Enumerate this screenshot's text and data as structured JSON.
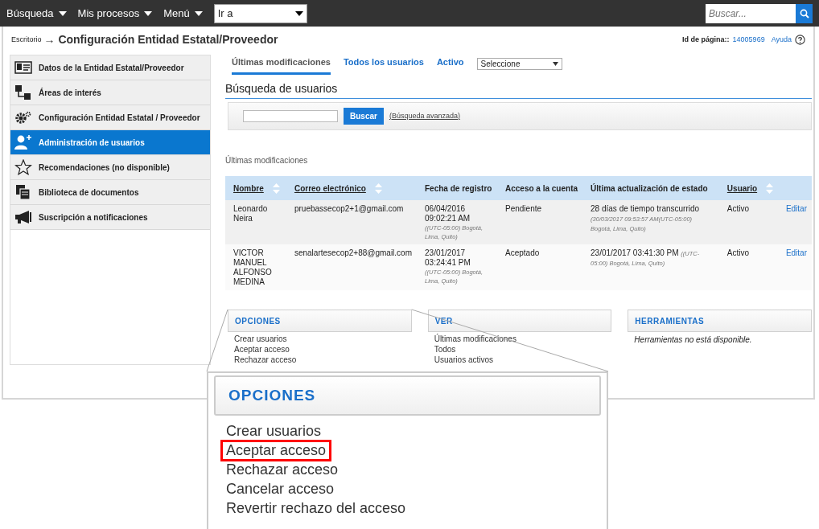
{
  "top_nav": {
    "menus": [
      {
        "label": "Búsqueda"
      },
      {
        "label": "Mis procesos"
      },
      {
        "label": "Menú"
      }
    ],
    "goto": {
      "value": "Ir a"
    },
    "search": {
      "placeholder": "Buscar..."
    }
  },
  "breadcrumb": {
    "link": "Escritorio",
    "arrow": "→",
    "title": "Configuración Entidad Estatal/Proveedor"
  },
  "page_id": {
    "label": "Id de página::",
    "value": "14005969"
  },
  "help": {
    "label": "Ayuda"
  },
  "sidebar": {
    "items": [
      {
        "label": "Datos de la Entidad Estatal/Proveedor",
        "selected": false
      },
      {
        "label": "Áreas de interés",
        "selected": false
      },
      {
        "label": "Configuración Entidad Estatal / Proveedor",
        "selected": false
      },
      {
        "label": "Administración de usuarios",
        "selected": true
      },
      {
        "label": "Recomendaciones (no disponible)",
        "selected": false
      },
      {
        "label": "Biblioteca de documentos",
        "selected": false
      },
      {
        "label": "Suscripción a notificaciones",
        "selected": false
      }
    ]
  },
  "tabs": [
    {
      "label": "Últimas modificaciones",
      "selected": true
    },
    {
      "label": "Todos los usuarios",
      "selected": false
    },
    {
      "label": "Activo",
      "selected": false
    }
  ],
  "filter_select": {
    "value": "Seleccione"
  },
  "user_search": {
    "title": "Búsqueda de usuarios",
    "button": "Buscar",
    "advanced_link": "(Búsqueda avanzada)"
  },
  "table": {
    "caption": "Últimas modificaciones",
    "columns": [
      {
        "label": "Nombre",
        "sortable": true
      },
      {
        "label": "Correo electrónico",
        "sortable": true
      },
      {
        "label": "Fecha de registro",
        "sortable": false
      },
      {
        "label": "Acceso a la cuenta",
        "sortable": false
      },
      {
        "label": "Última actualización de estado",
        "sortable": false
      },
      {
        "label": "Usuario",
        "sortable": true
      }
    ],
    "rows": [
      {
        "name": "Leonardo Neira",
        "email": "pruebassecop2+1@gmail.com",
        "date": "06/04/2016 09:02:21 AM",
        "date_zone": "((UTC-05:00) Bogotá, Lima, Quito)",
        "access": "Pendiente",
        "update": "28 días de tiempo transcurrido",
        "update_detail": "(30/03/2017 09:53:57 AM(UTC-05:00) Bogotá, Lima, Quito)",
        "status": "Activo",
        "action": "Editar"
      },
      {
        "name": "VICTOR MANUEL ALFONSO MEDINA",
        "email": "senalartesecop2+88@gmail.com",
        "date": "23/01/2017 03:24:41 PM",
        "date_zone": "((UTC-05:00) Bogotá, Lima, Quito)",
        "access": "Aceptado",
        "update": "23/01/2017 03:41:30 PM",
        "update_detail": "((UTC-05:00) Bogotá, Lima, Quito)",
        "status": "Activo",
        "action": "Editar"
      }
    ]
  },
  "panels": [
    {
      "title": "OPCIONES",
      "items": [
        "Crear usuarios",
        "Aceptar acceso",
        "Rechazar acceso"
      ]
    },
    {
      "title": "VER",
      "items": [
        "Últimas modificaciones",
        "Todos",
        "Usuarios activos"
      ]
    },
    {
      "title": "HERRAMIENTAS",
      "note": "Herramientas no está disponible."
    }
  ],
  "zoom_callout": {
    "title": "OPCIONES",
    "items": [
      {
        "label": "Crear usuarios",
        "highlighted": false
      },
      {
        "label": "Aceptar acceso",
        "highlighted": true
      },
      {
        "label": "Rechazar acceso",
        "highlighted": false
      },
      {
        "label": "Cancelar acceso",
        "highlighted": false
      },
      {
        "label": "Revertir rechazo del acceso",
        "highlighted": false
      }
    ]
  }
}
